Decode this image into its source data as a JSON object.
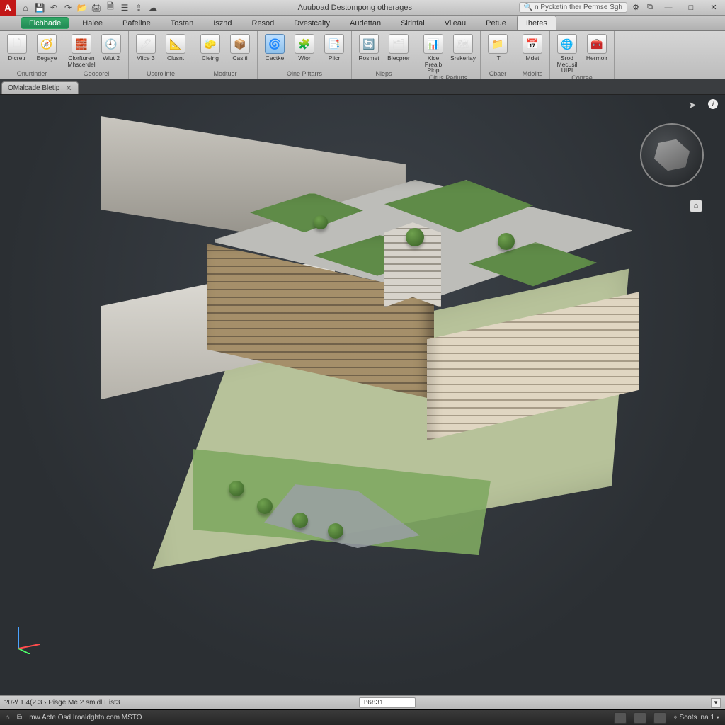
{
  "titlebar": {
    "app_letter": "A",
    "qat_icons": [
      "home",
      "save",
      "undo",
      "redo",
      "open",
      "plot",
      "sep",
      "print",
      "layers",
      "sep",
      "export",
      "cloud"
    ],
    "title": "Auuboad Destompong otherages",
    "search_placeholder": "n Pycketin ther Permse Sgh",
    "win_min": "—",
    "win_max": "□",
    "win_close": "✕"
  },
  "menubar": {
    "items": [
      {
        "label": "Fichbade",
        "active": false,
        "first": true
      },
      {
        "label": "Halee"
      },
      {
        "label": "Pafeline"
      },
      {
        "label": "Tostan"
      },
      {
        "label": "Isznd"
      },
      {
        "label": "Resod"
      },
      {
        "label": "Dvestcalty"
      },
      {
        "label": "Audettan"
      },
      {
        "label": "Sirinfal"
      },
      {
        "label": "Vileau"
      },
      {
        "label": "Petue"
      },
      {
        "label": "Ihetes",
        "active": true
      }
    ]
  },
  "ribbon": {
    "groups": [
      {
        "label": "Onurtinder",
        "tools": [
          {
            "label": "Dicretr",
            "glyph": "🗋"
          },
          {
            "label": "Eegaye",
            "glyph": "🧭"
          }
        ]
      },
      {
        "label": "Geosorel",
        "tools": [
          {
            "label": "Clorfturen Mhscerdel",
            "glyph": "🧱"
          },
          {
            "label": "Wlut 2",
            "glyph": "🕘"
          }
        ]
      },
      {
        "label": "Uscrolinfe",
        "tools": [
          {
            "label": "Vlice 3",
            "glyph": "🖊"
          },
          {
            "label": "Clusnt",
            "glyph": "📐"
          }
        ]
      },
      {
        "label": "Modtuer",
        "tools": [
          {
            "label": "Cleing",
            "glyph": "🧽"
          },
          {
            "label": "Casiti",
            "glyph": "📦"
          }
        ]
      },
      {
        "label": "Oine Piftarrs",
        "tools": [
          {
            "label": "Cactke",
            "glyph": "🌀",
            "active": true
          },
          {
            "label": "Wior",
            "glyph": "🧩"
          },
          {
            "label": "Plicr",
            "glyph": "📑"
          }
        ]
      },
      {
        "label": "Nieps",
        "tools": [
          {
            "label": "Rosmet",
            "glyph": "🔄"
          },
          {
            "label": "Biecprer",
            "glyph": "🗂"
          }
        ]
      },
      {
        "label": "Oitus Pedurts",
        "tools": [
          {
            "label": "Kice Prealb Plop",
            "glyph": "📊"
          },
          {
            "label": "Srekerlay",
            "glyph": "🗺"
          }
        ]
      },
      {
        "label": "Cbaer",
        "tools": [
          {
            "label": "IT",
            "glyph": "📁"
          }
        ]
      },
      {
        "label": "Mdolits",
        "tools": [
          {
            "label": "Mdet",
            "glyph": "📅"
          }
        ]
      },
      {
        "label": "Conree",
        "tools": [
          {
            "label": "Srod Mecusil UIPI",
            "glyph": "🌐"
          },
          {
            "label": "Hermoir",
            "glyph": "🧰"
          }
        ]
      }
    ]
  },
  "doctab": {
    "label": "OMalcade Bletip",
    "close": "✕"
  },
  "viewport": {
    "info": "i",
    "nav_arrow": "➤",
    "steer_glyph": "⌂"
  },
  "status1": {
    "left": "?02/ 1 4(2.3 › Pisge Me.2 smidl Eist3",
    "cmd": "I:6831"
  },
  "status2": {
    "left1": "⌂",
    "left2": "⧉",
    "text": "mw.Acte Osd Iroaldghtn.com  MSTO",
    "right": "⌖  Scots ina 1  ▾"
  }
}
